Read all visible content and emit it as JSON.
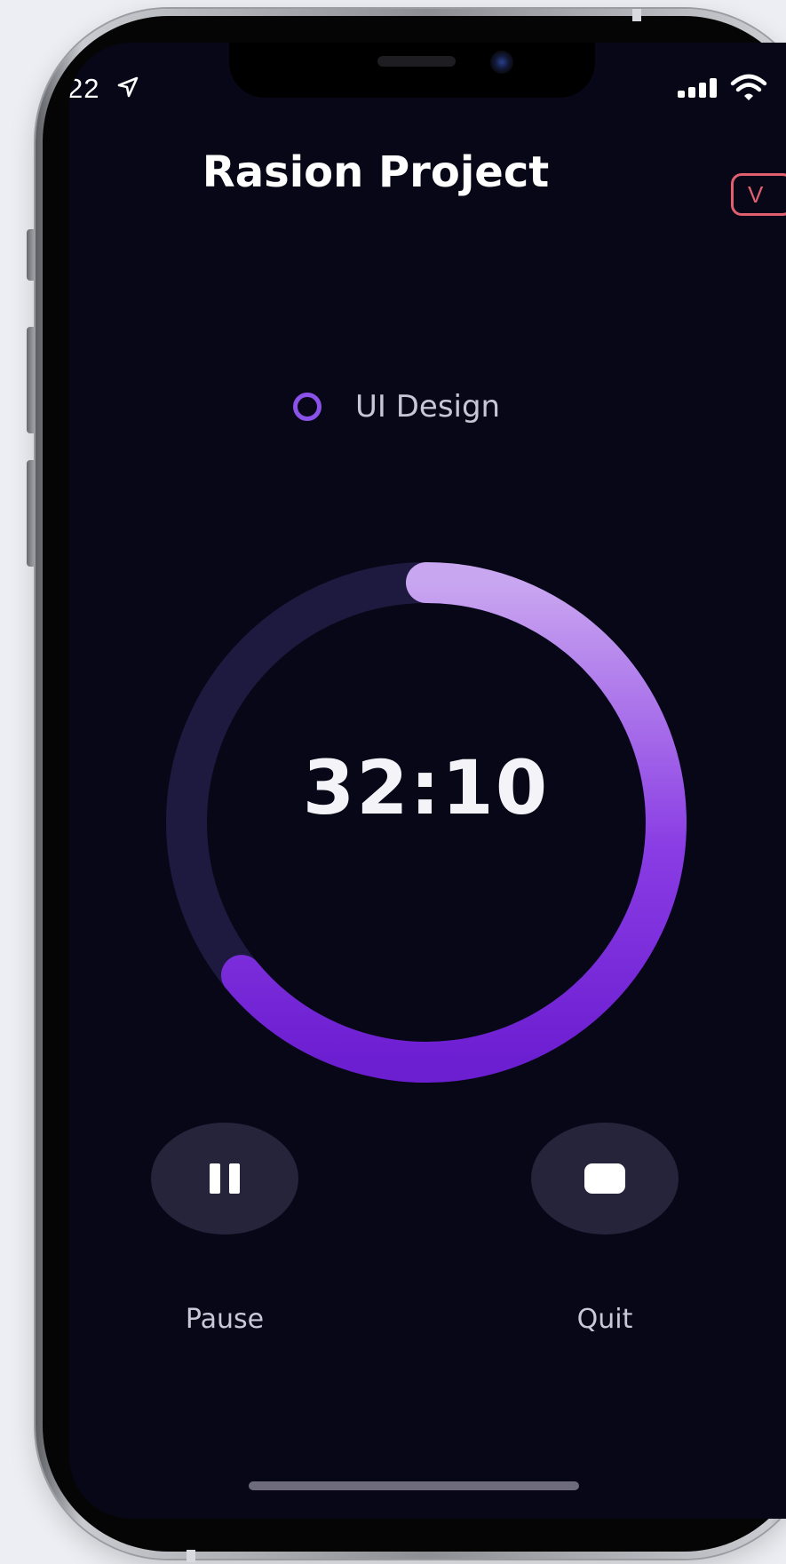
{
  "status_bar": {
    "time": "22",
    "location_icon": "location-arrow-icon",
    "signal_icon": "cellular-signal-icon",
    "wifi_icon": "wifi-icon"
  },
  "header": {
    "title": "Rasion Project",
    "action_label": "V"
  },
  "task": {
    "label": "UI Design",
    "indicator_icon": "circle-icon"
  },
  "timer": {
    "display": "32:10",
    "progress_fraction": 0.64,
    "colors": {
      "track": "#1e1a3f",
      "progress_start": "#c9a6f0",
      "progress_end": "#6c1ed1"
    }
  },
  "controls": {
    "pause": {
      "label": "Pause",
      "icon": "pause-icon"
    },
    "quit": {
      "label": "Quit",
      "icon": "stop-icon"
    }
  },
  "colors": {
    "screen_background": "#080718",
    "accent": "#8a52e8",
    "header_action": "#e06070"
  }
}
